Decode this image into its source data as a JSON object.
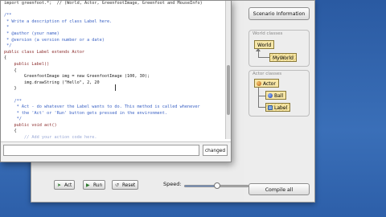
{
  "scenario": {
    "scenario_information_button": "Scenario Information",
    "world_group_label": "World classes",
    "world_classes": [
      "World",
      "MyWorld"
    ],
    "actor_group_label": "Actor classes",
    "actor_classes": [
      "Actor",
      "Ball",
      "Label"
    ],
    "compile_all_button": "Compile all"
  },
  "controls": {
    "act_label": "Act",
    "run_label": "Run",
    "reset_label": "Reset",
    "speed_label": "Speed:",
    "speed_fraction": 0.5
  },
  "editor": {
    "status_text": "",
    "changed_label": "changed",
    "code_lines": [
      "import greenfoot.*;  // (World, Actor, GreenfootImage, Greenfoot and MouseInfo)",
      "",
      "/**",
      " * Write a description of class Label here.",
      " *",
      " * @author (your name)",
      " * @version (a version number or a date)",
      " */",
      "public class Label extends Actor",
      "{",
      "    public Label()",
      "    {",
      "        GreenfootImage img = new GreenfootImage (100, 30);",
      "        img.drawString (\"Hello\", 2, 20",
      "    }",
      "",
      "    /**",
      "     * Act - do whatever the Label wants to do. This method is called whenever",
      "     * the 'Act' or 'Run' button gets pressed in the environment.",
      "     */",
      "    public void act()",
      "    {",
      "        // Add your action code here.",
      "    }"
    ]
  },
  "colors": {
    "desktop": "#2e5fa6",
    "class_box": "#f7e7a8",
    "comment": "#3b62c4",
    "keyword": "#8a2a2a",
    "string": "#1e7a2b"
  }
}
